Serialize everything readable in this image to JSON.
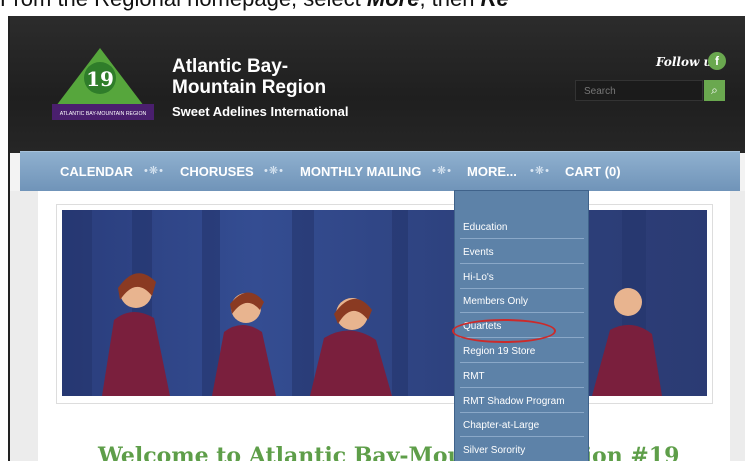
{
  "caption": {
    "prefix": "From the Regional homepage, select ",
    "more": "More",
    "suffix": ", then ",
    "tail": "Re"
  },
  "header": {
    "logo_text": "ATLANTIC BAY-MOUNTAIN REGION",
    "logo_number": "19",
    "title_line1": "Atlantic Bay-",
    "title_line2": "Mountain Region",
    "subtitle": "Sweet Adelines International",
    "follow_label": "Follow us",
    "facebook_glyph": "f",
    "search_placeholder": "Search",
    "search_glyph": "⌕"
  },
  "nav": {
    "separator": "•❋•",
    "items": [
      "CALENDAR",
      "CHORUSES",
      "MONTHLY MAILING",
      "MORE...",
      "CART (0)"
    ]
  },
  "dropdown": {
    "items": [
      "Education",
      "Events",
      "Hi-Lo's",
      "Members Only",
      "Quartets",
      "Region 19 Store",
      "RMT",
      "RMT Shadow Program",
      "Chapter-at-Large",
      "Silver Sorority"
    ],
    "highlighted_index": 5
  },
  "hero": {
    "slide_count": 23,
    "active_slide": 1
  },
  "main": {
    "welcome_title": "Welcome to Atlantic Bay-Mountain Region #19"
  },
  "colors": {
    "accent_green": "#6aa84f",
    "nav_blue": "#7a9cc1",
    "highlight_red": "#cc2a2a",
    "dark_header": "#262626"
  }
}
